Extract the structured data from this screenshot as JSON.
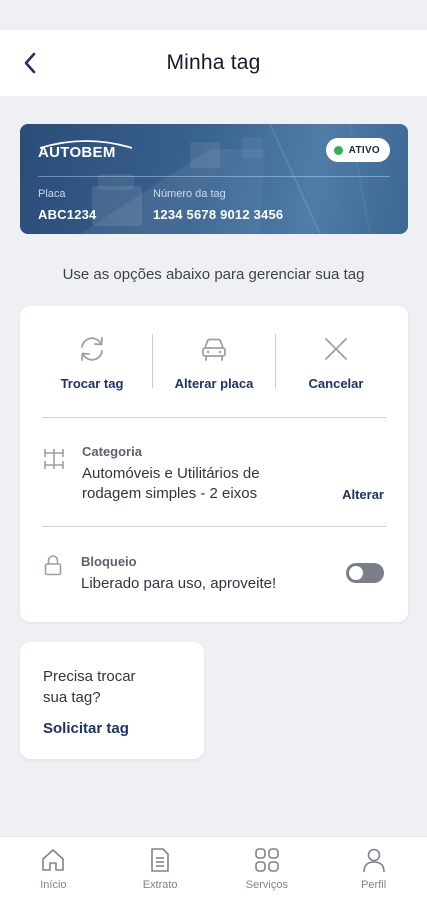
{
  "header": {
    "title": "Minha tag"
  },
  "tag_card": {
    "brand": "AUTOBEM",
    "status": "ATIVO",
    "status_color": "#2fb34a",
    "plate_label": "Placa",
    "plate_value": "ABC1234",
    "tag_number_label": "Número da tag",
    "tag_number_value": "1234 5678 9012 3456"
  },
  "hint": "Use as opções abaixo para gerenciar sua tag",
  "actions": [
    {
      "label": "Trocar tag",
      "icon": "refresh-icon"
    },
    {
      "label": "Alterar placa",
      "icon": "car-icon"
    },
    {
      "label": "Cancelar",
      "icon": "close-icon"
    }
  ],
  "category": {
    "title": "Categoria",
    "description_line1": "Automóveis e Utilitários de",
    "description_line2": "rodagem simples - 2 eixos",
    "link": "Alterar",
    "icon": "axle-icon"
  },
  "lock": {
    "title": "Bloqueio",
    "description": "Liberado para uso, aproveite!",
    "toggle_on": false,
    "icon": "lock-icon"
  },
  "request": {
    "text_line1": "Precisa trocar",
    "text_line2": "sua tag?",
    "link": "Solicitar tag"
  },
  "bottom_nav": [
    {
      "label": "Início",
      "icon": "home-icon"
    },
    {
      "label": "Extrato",
      "icon": "document-icon"
    },
    {
      "label": "Serviços",
      "icon": "grid-icon"
    },
    {
      "label": "Perfil",
      "icon": "user-icon"
    }
  ],
  "colors": {
    "accent": "#1f3463",
    "card_blue": "#38628f",
    "background": "#eef0f3"
  }
}
